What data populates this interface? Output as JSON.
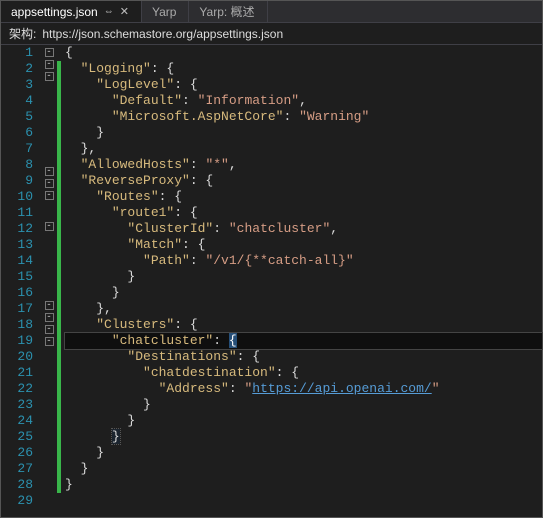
{
  "tabs": [
    {
      "label": "appsettings.json",
      "active": true,
      "pinned": true,
      "closeable": true
    },
    {
      "label": "Yarp",
      "active": false
    },
    {
      "label": "Yarp: 概述",
      "active": false
    }
  ],
  "schema": {
    "label": "架构:",
    "url": "https://json.schemastore.org/appsettings.json"
  },
  "lines": [
    {
      "n": 1,
      "fold": "box",
      "mod": false,
      "seg": [
        {
          "t": "{",
          "c": "brace"
        }
      ]
    },
    {
      "n": 2,
      "fold": "box",
      "mod": true,
      "seg": [
        {
          "t": "  "
        },
        {
          "t": "\"Logging\"",
          "c": "key"
        },
        {
          "t": ": {",
          "c": "brace"
        }
      ]
    },
    {
      "n": 3,
      "fold": "box",
      "mod": true,
      "seg": [
        {
          "t": "    "
        },
        {
          "t": "\"LogLevel\"",
          "c": "key"
        },
        {
          "t": ": {",
          "c": "brace"
        }
      ]
    },
    {
      "n": 4,
      "fold": "",
      "mod": true,
      "seg": [
        {
          "t": "      "
        },
        {
          "t": "\"Default\"",
          "c": "key"
        },
        {
          "t": ": "
        },
        {
          "t": "\"Information\"",
          "c": "str"
        },
        {
          "t": ",",
          "c": "brace"
        }
      ]
    },
    {
      "n": 5,
      "fold": "",
      "mod": true,
      "seg": [
        {
          "t": "      "
        },
        {
          "t": "\"Microsoft.AspNetCore\"",
          "c": "key"
        },
        {
          "t": ": "
        },
        {
          "t": "\"Warning\"",
          "c": "str"
        }
      ]
    },
    {
      "n": 6,
      "fold": "",
      "mod": true,
      "seg": [
        {
          "t": "    "
        },
        {
          "t": "}",
          "c": "brace"
        }
      ]
    },
    {
      "n": 7,
      "fold": "",
      "mod": true,
      "seg": [
        {
          "t": "  "
        },
        {
          "t": "},",
          "c": "brace"
        }
      ]
    },
    {
      "n": 8,
      "fold": "",
      "mod": true,
      "seg": [
        {
          "t": "  "
        },
        {
          "t": "\"AllowedHosts\"",
          "c": "key"
        },
        {
          "t": ": "
        },
        {
          "t": "\"*\"",
          "c": "str"
        },
        {
          "t": ",",
          "c": "brace"
        }
      ]
    },
    {
      "n": 9,
      "fold": "box",
      "mod": true,
      "seg": [
        {
          "t": "  "
        },
        {
          "t": "\"ReverseProxy\"",
          "c": "key"
        },
        {
          "t": ": {",
          "c": "brace"
        }
      ]
    },
    {
      "n": 10,
      "fold": "box",
      "mod": true,
      "seg": [
        {
          "t": "    "
        },
        {
          "t": "\"Routes\"",
          "c": "key"
        },
        {
          "t": ": {",
          "c": "brace"
        }
      ]
    },
    {
      "n": 11,
      "fold": "box",
      "mod": true,
      "seg": [
        {
          "t": "      "
        },
        {
          "t": "\"route1\"",
          "c": "key"
        },
        {
          "t": ": {",
          "c": "brace"
        }
      ]
    },
    {
      "n": 12,
      "fold": "",
      "mod": true,
      "seg": [
        {
          "t": "        "
        },
        {
          "t": "\"ClusterId\"",
          "c": "key"
        },
        {
          "t": ": "
        },
        {
          "t": "\"chatcluster\"",
          "c": "str"
        },
        {
          "t": ",",
          "c": "brace"
        }
      ]
    },
    {
      "n": 13,
      "fold": "box",
      "mod": true,
      "seg": [
        {
          "t": "        "
        },
        {
          "t": "\"Match\"",
          "c": "key"
        },
        {
          "t": ": {",
          "c": "brace"
        }
      ]
    },
    {
      "n": 14,
      "fold": "",
      "mod": true,
      "seg": [
        {
          "t": "          "
        },
        {
          "t": "\"Path\"",
          "c": "key"
        },
        {
          "t": ": "
        },
        {
          "t": "\"/v1/{**catch-all}\"",
          "c": "str"
        }
      ]
    },
    {
      "n": 15,
      "fold": "",
      "mod": true,
      "seg": [
        {
          "t": "        "
        },
        {
          "t": "}",
          "c": "brace"
        }
      ]
    },
    {
      "n": 16,
      "fold": "",
      "mod": true,
      "seg": [
        {
          "t": "      "
        },
        {
          "t": "}",
          "c": "brace"
        }
      ]
    },
    {
      "n": 17,
      "fold": "",
      "mod": true,
      "seg": [
        {
          "t": "    "
        },
        {
          "t": "},",
          "c": "brace"
        }
      ]
    },
    {
      "n": 18,
      "fold": "box",
      "mod": true,
      "seg": [
        {
          "t": "    "
        },
        {
          "t": "\"Clusters\"",
          "c": "key"
        },
        {
          "t": ": {",
          "c": "brace"
        }
      ]
    },
    {
      "n": 19,
      "fold": "box",
      "mod": true,
      "current": true,
      "seg": [
        {
          "t": "      "
        },
        {
          "t": "\"chatcluster\"",
          "c": "key"
        },
        {
          "t": ": "
        },
        {
          "t": "{",
          "c": "brace caret"
        }
      ]
    },
    {
      "n": 20,
      "fold": "box",
      "mod": true,
      "seg": [
        {
          "t": "        "
        },
        {
          "t": "\"Destinations\"",
          "c": "key"
        },
        {
          "t": ": {",
          "c": "brace"
        }
      ]
    },
    {
      "n": 21,
      "fold": "box",
      "mod": true,
      "seg": [
        {
          "t": "          "
        },
        {
          "t": "\"chatdestination\"",
          "c": "key"
        },
        {
          "t": ": {",
          "c": "brace"
        }
      ]
    },
    {
      "n": 22,
      "fold": "",
      "mod": true,
      "seg": [
        {
          "t": "            "
        },
        {
          "t": "\"Address\"",
          "c": "key"
        },
        {
          "t": ": "
        },
        {
          "t": "\"",
          "c": "str"
        },
        {
          "t": "https://api.openai.com/",
          "c": "link"
        },
        {
          "t": "\"",
          "c": "str"
        }
      ]
    },
    {
      "n": 23,
      "fold": "",
      "mod": true,
      "seg": [
        {
          "t": "          "
        },
        {
          "t": "}",
          "c": "brace"
        }
      ]
    },
    {
      "n": 24,
      "fold": "",
      "mod": true,
      "seg": [
        {
          "t": "        "
        },
        {
          "t": "}",
          "c": "brace"
        }
      ]
    },
    {
      "n": 25,
      "fold": "",
      "mod": true,
      "seg": [
        {
          "t": "      "
        },
        {
          "t": "}",
          "c": "brace bracebox"
        }
      ]
    },
    {
      "n": 26,
      "fold": "",
      "mod": true,
      "seg": [
        {
          "t": "    "
        },
        {
          "t": "}",
          "c": "brace"
        }
      ]
    },
    {
      "n": 27,
      "fold": "",
      "mod": true,
      "seg": [
        {
          "t": "  "
        },
        {
          "t": "}",
          "c": "brace"
        }
      ]
    },
    {
      "n": 28,
      "fold": "",
      "mod": true,
      "seg": [
        {
          "t": "}",
          "c": "brace"
        }
      ]
    },
    {
      "n": 29,
      "fold": "",
      "mod": false,
      "seg": []
    }
  ]
}
